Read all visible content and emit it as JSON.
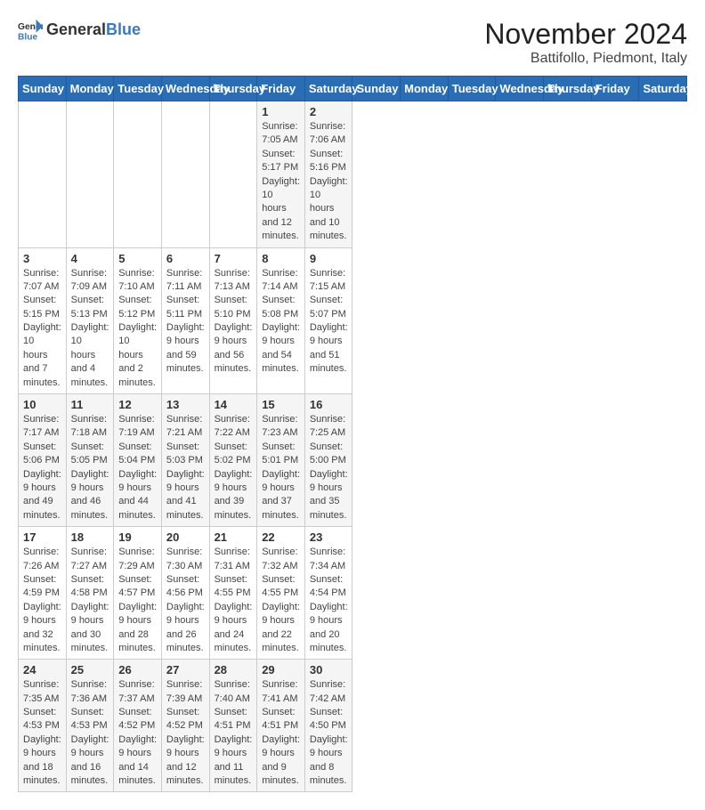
{
  "header": {
    "logo_general": "General",
    "logo_blue": "Blue",
    "month_title": "November 2024",
    "location": "Battifollo, Piedmont, Italy"
  },
  "days_of_week": [
    "Sunday",
    "Monday",
    "Tuesday",
    "Wednesday",
    "Thursday",
    "Friday",
    "Saturday"
  ],
  "weeks": [
    [
      {
        "day": "",
        "info": ""
      },
      {
        "day": "",
        "info": ""
      },
      {
        "day": "",
        "info": ""
      },
      {
        "day": "",
        "info": ""
      },
      {
        "day": "",
        "info": ""
      },
      {
        "day": "1",
        "info": "Sunrise: 7:05 AM\nSunset: 5:17 PM\nDaylight: 10 hours and 12 minutes."
      },
      {
        "day": "2",
        "info": "Sunrise: 7:06 AM\nSunset: 5:16 PM\nDaylight: 10 hours and 10 minutes."
      }
    ],
    [
      {
        "day": "3",
        "info": "Sunrise: 7:07 AM\nSunset: 5:15 PM\nDaylight: 10 hours and 7 minutes."
      },
      {
        "day": "4",
        "info": "Sunrise: 7:09 AM\nSunset: 5:13 PM\nDaylight: 10 hours and 4 minutes."
      },
      {
        "day": "5",
        "info": "Sunrise: 7:10 AM\nSunset: 5:12 PM\nDaylight: 10 hours and 2 minutes."
      },
      {
        "day": "6",
        "info": "Sunrise: 7:11 AM\nSunset: 5:11 PM\nDaylight: 9 hours and 59 minutes."
      },
      {
        "day": "7",
        "info": "Sunrise: 7:13 AM\nSunset: 5:10 PM\nDaylight: 9 hours and 56 minutes."
      },
      {
        "day": "8",
        "info": "Sunrise: 7:14 AM\nSunset: 5:08 PM\nDaylight: 9 hours and 54 minutes."
      },
      {
        "day": "9",
        "info": "Sunrise: 7:15 AM\nSunset: 5:07 PM\nDaylight: 9 hours and 51 minutes."
      }
    ],
    [
      {
        "day": "10",
        "info": "Sunrise: 7:17 AM\nSunset: 5:06 PM\nDaylight: 9 hours and 49 minutes."
      },
      {
        "day": "11",
        "info": "Sunrise: 7:18 AM\nSunset: 5:05 PM\nDaylight: 9 hours and 46 minutes."
      },
      {
        "day": "12",
        "info": "Sunrise: 7:19 AM\nSunset: 5:04 PM\nDaylight: 9 hours and 44 minutes."
      },
      {
        "day": "13",
        "info": "Sunrise: 7:21 AM\nSunset: 5:03 PM\nDaylight: 9 hours and 41 minutes."
      },
      {
        "day": "14",
        "info": "Sunrise: 7:22 AM\nSunset: 5:02 PM\nDaylight: 9 hours and 39 minutes."
      },
      {
        "day": "15",
        "info": "Sunrise: 7:23 AM\nSunset: 5:01 PM\nDaylight: 9 hours and 37 minutes."
      },
      {
        "day": "16",
        "info": "Sunrise: 7:25 AM\nSunset: 5:00 PM\nDaylight: 9 hours and 35 minutes."
      }
    ],
    [
      {
        "day": "17",
        "info": "Sunrise: 7:26 AM\nSunset: 4:59 PM\nDaylight: 9 hours and 32 minutes."
      },
      {
        "day": "18",
        "info": "Sunrise: 7:27 AM\nSunset: 4:58 PM\nDaylight: 9 hours and 30 minutes."
      },
      {
        "day": "19",
        "info": "Sunrise: 7:29 AM\nSunset: 4:57 PM\nDaylight: 9 hours and 28 minutes."
      },
      {
        "day": "20",
        "info": "Sunrise: 7:30 AM\nSunset: 4:56 PM\nDaylight: 9 hours and 26 minutes."
      },
      {
        "day": "21",
        "info": "Sunrise: 7:31 AM\nSunset: 4:55 PM\nDaylight: 9 hours and 24 minutes."
      },
      {
        "day": "22",
        "info": "Sunrise: 7:32 AM\nSunset: 4:55 PM\nDaylight: 9 hours and 22 minutes."
      },
      {
        "day": "23",
        "info": "Sunrise: 7:34 AM\nSunset: 4:54 PM\nDaylight: 9 hours and 20 minutes."
      }
    ],
    [
      {
        "day": "24",
        "info": "Sunrise: 7:35 AM\nSunset: 4:53 PM\nDaylight: 9 hours and 18 minutes."
      },
      {
        "day": "25",
        "info": "Sunrise: 7:36 AM\nSunset: 4:53 PM\nDaylight: 9 hours and 16 minutes."
      },
      {
        "day": "26",
        "info": "Sunrise: 7:37 AM\nSunset: 4:52 PM\nDaylight: 9 hours and 14 minutes."
      },
      {
        "day": "27",
        "info": "Sunrise: 7:39 AM\nSunset: 4:52 PM\nDaylight: 9 hours and 12 minutes."
      },
      {
        "day": "28",
        "info": "Sunrise: 7:40 AM\nSunset: 4:51 PM\nDaylight: 9 hours and 11 minutes."
      },
      {
        "day": "29",
        "info": "Sunrise: 7:41 AM\nSunset: 4:51 PM\nDaylight: 9 hours and 9 minutes."
      },
      {
        "day": "30",
        "info": "Sunrise: 7:42 AM\nSunset: 4:50 PM\nDaylight: 9 hours and 8 minutes."
      }
    ]
  ]
}
